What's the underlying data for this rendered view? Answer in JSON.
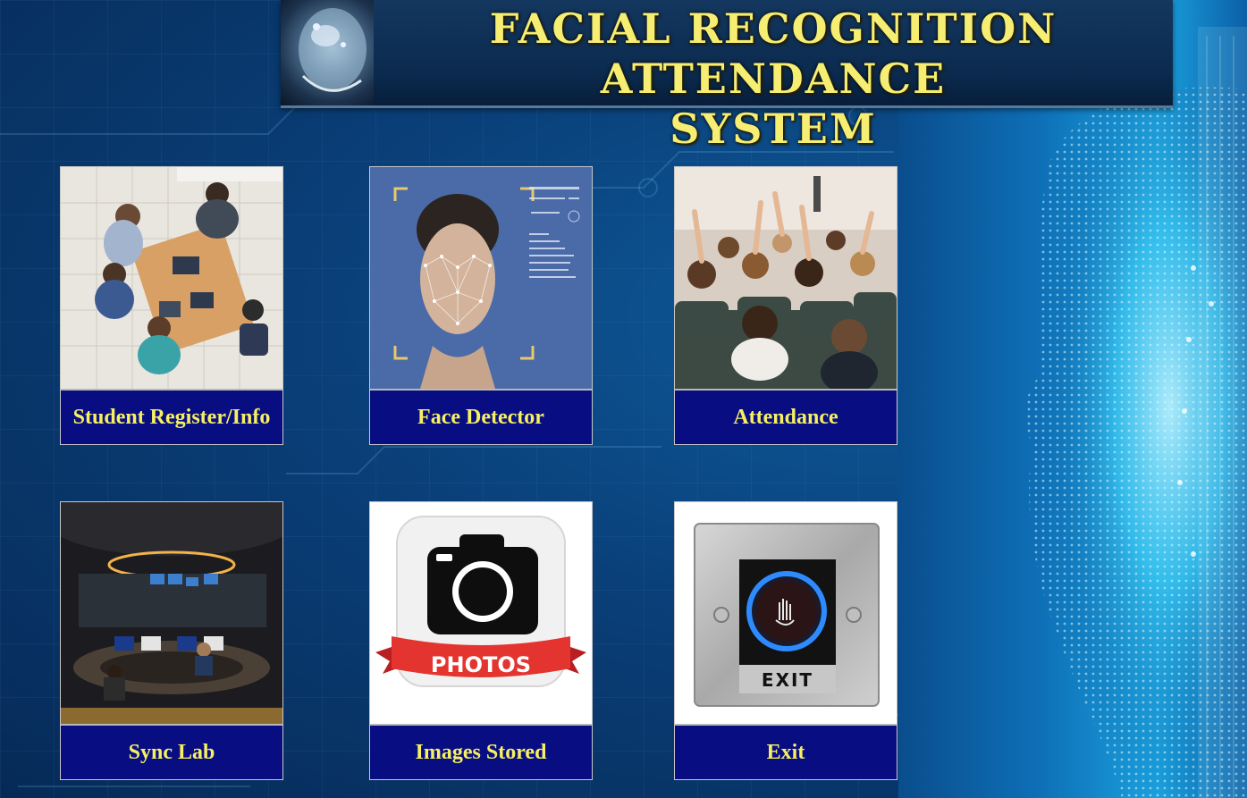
{
  "banner": {
    "title_line1": "FACIAL RECOGNITION ATTENDANCE",
    "title_line2": "SYSTEM"
  },
  "tiles": [
    {
      "label": "Student Register/Info",
      "icon": "students-image"
    },
    {
      "label": "Face Detector",
      "icon": "face-scan-image"
    },
    {
      "label": "Attendance",
      "icon": "classroom-image"
    },
    {
      "label": "Sync Lab",
      "icon": "computer-lab-image"
    },
    {
      "label": "Images Stored",
      "icon": "camera-photos-image"
    },
    {
      "label": "Exit",
      "icon": "exit-button-image"
    }
  ],
  "photo_texts": {
    "photos_banner": "PHOTOS",
    "exit_plate": "EXIT"
  },
  "colors": {
    "title": "#f5ee72",
    "tile_label_bg": "#080e82",
    "tile_label_text": "#f7f061",
    "background": "#0a3f78"
  }
}
